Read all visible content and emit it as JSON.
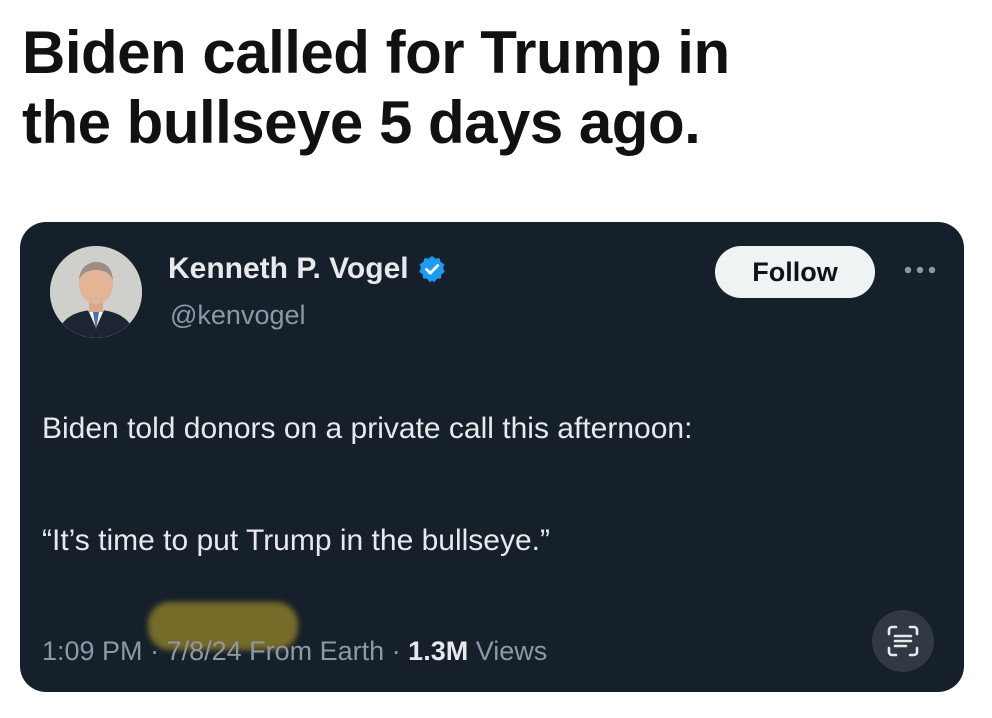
{
  "headline": {
    "line_1": "Biden called for Trump in",
    "line_2": "the bullseye 5 days ago."
  },
  "tweet": {
    "author": {
      "display_name": "Kenneth P. Vogel",
      "handle": "@kenvogel",
      "avatar_icon": "profile-photo",
      "verified_icon": "verified-badge-icon"
    },
    "follow_label": "Follow",
    "more_icon": "more-options-icon",
    "text_line_1": "Biden told donors on a private call this afternoon:",
    "text_line_2": "“It’s time to put Trump in the bullseye.”",
    "meta": {
      "time": "1:09 PM",
      "separator_1": " · ",
      "date": "7/8/24",
      "source": " From Earth",
      "separator_2": " · ",
      "views_count": "1.3M",
      "views_label": " Views"
    },
    "scan_icon": "text-scan-icon"
  },
  "colors": {
    "card_background": "#15202b",
    "verified_blue": "#1d9bf0",
    "text_primary": "#e7e9ea",
    "text_secondary": "#8b98a5",
    "follow_button_bg": "#eff3f4",
    "highlight_mark": "#c8aa28"
  }
}
